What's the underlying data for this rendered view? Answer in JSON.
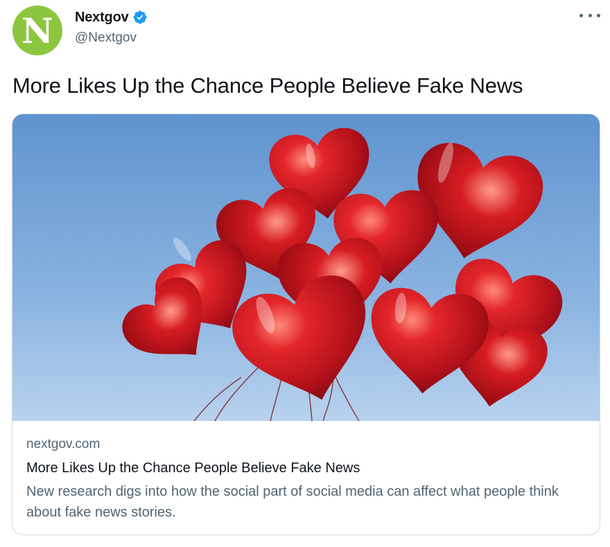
{
  "author": {
    "avatar_letter": "N",
    "avatar_color": "#8cc63e",
    "display_name": "Nextgov",
    "handle": "@Nextgov",
    "verified": true,
    "verified_icon": "verified-badge-icon"
  },
  "more_menu_icon": "more-dots-icon",
  "tweet": {
    "text": "More Likes Up the Chance People Believe Fake News"
  },
  "card": {
    "image_description_icon": "heart-balloons-image",
    "domain": "nextgov.com",
    "title": "More Likes Up the Chance People Believe Fake News",
    "description": "New research digs into how the social part of social media can affect what people think about fake news stories."
  },
  "colors": {
    "text_primary": "#0f1419",
    "text_secondary": "#536471",
    "verified_blue": "#1d9bf0",
    "border": "#cfd9de",
    "balloon_red": "#c8141a",
    "sky_blue": "#6f9fd6"
  }
}
